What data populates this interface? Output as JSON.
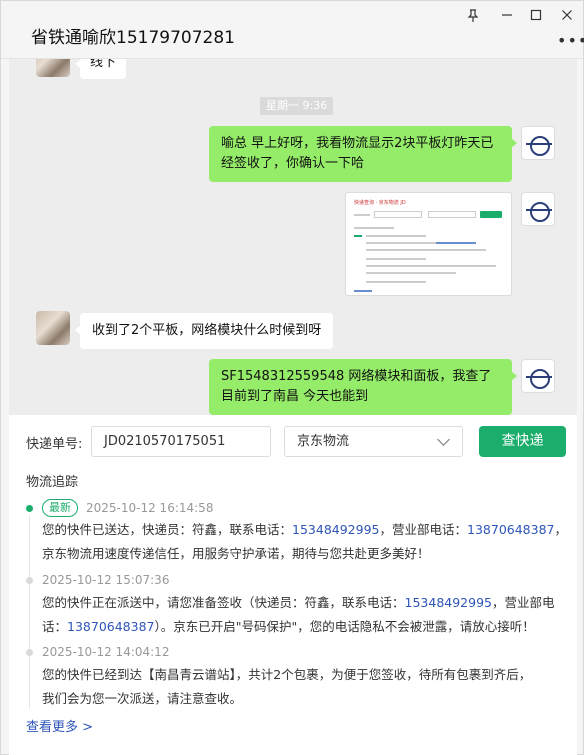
{
  "window": {
    "title": "省铁通喻欣15179707281",
    "more_icon": "more-dots-icon",
    "pin_icon": "pin-icon"
  },
  "chat": {
    "partial_message": "线下",
    "time_chip": "星期一 9:36",
    "messages": [
      {
        "side": "self",
        "text_1": "喻总  早上好呀，我看物流显示2块平板灯昨天已",
        "text_2": "经签收了，你确认一下哈"
      },
      {
        "side": "self",
        "type": "image",
        "image_title": "快递查询 · 京东物流 JD"
      },
      {
        "side": "other",
        "text_1": "收到了2个平板，网络模块什么时候到呀"
      },
      {
        "side": "self",
        "text_1": "SF1548312559548      网络模块和面板，我查了",
        "text_2": "目前到了南昌  今天也能到"
      }
    ]
  },
  "query": {
    "waybill_label": "快递单号:",
    "waybill_value": "JD0210570175051",
    "carrier": "京东物流",
    "query_button": "查快递"
  },
  "tracking": {
    "title": "物流追踪",
    "latest_badge": "最新",
    "events": [
      {
        "time": "2025-10-12 16:14:58",
        "line1_a": "您的快件已送达，快递员：符鑫，联系电话：",
        "line1_phone1": "15348492995",
        "line1_b": "，营业部电话：",
        "line1_phone2": "13870648387",
        "line1_c": "，",
        "line2": "京东物流用速度传递信任，用服务守护承诺，期待与您共赴更多美好！"
      },
      {
        "time": "2025-10-12 15:07:36",
        "line1_a": "您的快件正在派送中，请您准备签收（快递员：符鑫，联系电话：",
        "line1_phone1": "15348492995",
        "line1_b": "，营业部电",
        "line2_a": "话：",
        "line2_phone": "13870648387",
        "line2_b": "）。京东已开启\"号码保护\"，您的电话隐私不会被泄露，请放心接听！"
      },
      {
        "time": "2025-10-12 14:04:12",
        "line1": "您的快件已经到达【南昌青云谱站】，共计2个包裹，为便于您签收，待所有包裹到齐后，",
        "line2": "我们会为您一次派送，请注意查收。"
      }
    ],
    "see_more": "查看更多 >"
  },
  "colors": {
    "accent_green": "#1aad6b",
    "bubble_green": "#95ec69",
    "link_blue": "#2e55b8"
  }
}
